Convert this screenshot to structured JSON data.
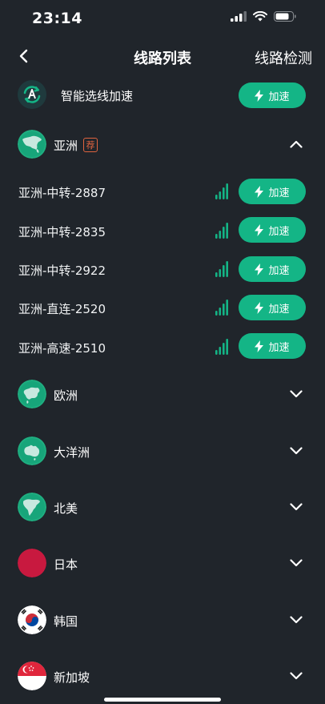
{
  "status_bar": {
    "time": "23:14"
  },
  "header": {
    "title": "线路列表",
    "right_action": "线路检测"
  },
  "smart": {
    "label": "智能选线加速",
    "button_label": "加速"
  },
  "regions": [
    {
      "name": "亚洲",
      "badge": "荐",
      "expanded": true
    },
    {
      "name": "欧洲",
      "expanded": false
    },
    {
      "name": "大洋洲",
      "expanded": false
    },
    {
      "name": "北美",
      "expanded": false
    },
    {
      "name": "日本",
      "expanded": false
    },
    {
      "name": "韩国",
      "expanded": false
    },
    {
      "name": "新加坡",
      "expanded": false
    }
  ],
  "asia_servers": [
    {
      "name": "亚洲-中转-2887",
      "button_label": "加速"
    },
    {
      "name": "亚洲-中转-2835",
      "button_label": "加速"
    },
    {
      "name": "亚洲-中转-2922",
      "button_label": "加速"
    },
    {
      "name": "亚洲-直连-2520",
      "button_label": "加速"
    },
    {
      "name": "亚洲-高速-2510",
      "button_label": "加速"
    }
  ],
  "colors": {
    "accent": "#14b586",
    "background": "#20252b",
    "badge": "#e0643f"
  }
}
